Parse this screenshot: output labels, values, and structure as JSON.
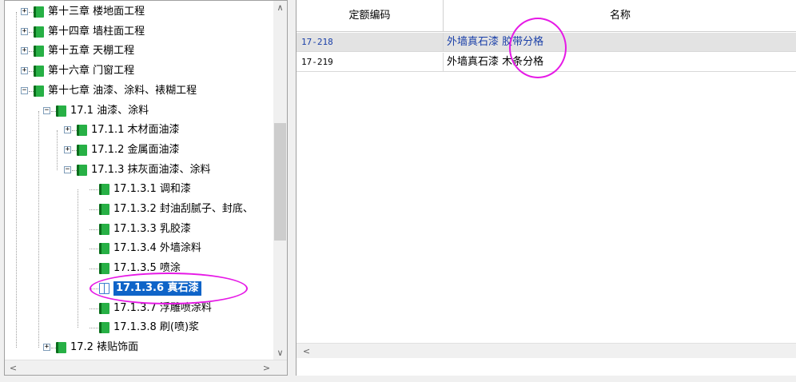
{
  "tree": {
    "rows": [
      {
        "text": "第十三章 楼地面工程",
        "expander": "+"
      },
      {
        "text": "第十四章 墙柱面工程",
        "expander": "+"
      },
      {
        "text": "第十五章 天棚工程",
        "expander": "+"
      },
      {
        "text": "第十六章 门窗工程",
        "expander": "+"
      },
      {
        "text": "第十七章 油漆、涂料、裱糊工程",
        "expander": "−"
      },
      {
        "text": "17.1  油漆、涂料",
        "expander": "−"
      },
      {
        "text": "17.1.1  木材面油漆",
        "expander": "+"
      },
      {
        "text": "17.1.2  金属面油漆",
        "expander": "+"
      },
      {
        "text": "17.1.3  抹灰面油漆、涂料",
        "expander": "−"
      },
      {
        "text": "17.1.3.1  调和漆",
        "expander": ""
      },
      {
        "text": "17.1.3.2  封油刮腻子、封底、",
        "expander": ""
      },
      {
        "text": "17.1.3.3  乳胶漆",
        "expander": ""
      },
      {
        "text": "17.1.3.4  外墙涂料",
        "expander": ""
      },
      {
        "text": "17.1.3.5  喷涂",
        "expander": ""
      },
      {
        "text": "17.1.3.6  真石漆",
        "expander": "",
        "selected": true
      },
      {
        "text": "17.1.3.7  浮雕喷涂料",
        "expander": ""
      },
      {
        "text": "17.1.3.8  刷(喷)浆",
        "expander": ""
      },
      {
        "text": "17.2  裱贴饰面",
        "expander": "+"
      }
    ],
    "scroll_up": "∧",
    "scroll_down": "∨",
    "scroll_left": "<",
    "scroll_right": ">"
  },
  "table": {
    "headers": [
      "定额编码",
      "名称"
    ],
    "rows": [
      {
        "code": "17-218",
        "name": "外墙真石漆 胶带分格",
        "selected": true
      },
      {
        "code": "17-219",
        "name": "外墙真石漆 木条分格"
      }
    ],
    "scroll_left": "<"
  },
  "colors": {
    "highlight_circle": "#e619e6",
    "selection": "#0f64c8",
    "book_icon": "#27b045"
  }
}
